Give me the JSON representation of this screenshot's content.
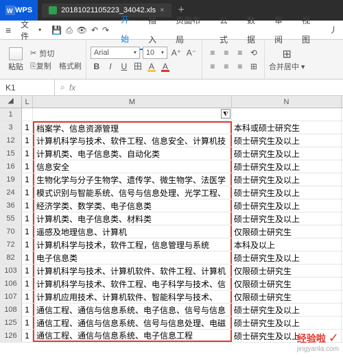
{
  "titlebar": {
    "app": "WPS",
    "tab_filename": "20181021105223_34042.xls",
    "add_tab": "+"
  },
  "menubar": {
    "hamburger": "≡",
    "file": "文件",
    "items": [
      "开始",
      "插入",
      "页面布局",
      "公式",
      "数据",
      "审阅",
      "视图",
      "丿"
    ],
    "active_index": 0
  },
  "toolbar": {
    "paste": "粘贴",
    "cut": "剪切",
    "copy": "复制",
    "format_painter": "格式刷",
    "font_name": "Arial",
    "font_size": "10",
    "bold": "B",
    "italic": "I",
    "underline": "U",
    "inc_font": "A⁺",
    "dec_font": "A⁻",
    "merge": "合并居中"
  },
  "cellref": {
    "address": "K1",
    "fx": "fx",
    "search": "⌕"
  },
  "columns": {
    "blank": "◢",
    "L": "L",
    "M": "M",
    "N": "N"
  },
  "filter_icon": "⧨",
  "rows": [
    {
      "n": "1",
      "l": "",
      "m": "",
      "n2": ""
    },
    {
      "n": "3",
      "l": "1",
      "m": "档案学、信息资源管理",
      "n2": "本科或硕士研究生"
    },
    {
      "n": "12",
      "l": "1",
      "m": "计算机科学与技术、软件工程、信息安全、计算机技",
      "n2": "硕士研究生及以上"
    },
    {
      "n": "15",
      "l": "1",
      "m": "计算机类、电子信息类、自动化类",
      "n2": "硕士研究生及以上"
    },
    {
      "n": "16",
      "l": "1",
      "m": "信息安全",
      "n2": "硕士研究生及以上"
    },
    {
      "n": "19",
      "l": "1",
      "m": "生物化学与分子生物学、遗传学、微生物学、法医学",
      "n2": "硕士研究生及以上"
    },
    {
      "n": "24",
      "l": "1",
      "m": "模式识别与智能系统、信号与信息处理、光学工程、",
      "n2": "硕士研究生及以上"
    },
    {
      "n": "36",
      "l": "1",
      "m": "经济学类、数学类、电子信息类",
      "n2": "硕士研究生及以上"
    },
    {
      "n": "55",
      "l": "1",
      "m": "计算机类、电子信息类、材料类",
      "n2": "硕士研究生及以上"
    },
    {
      "n": "70",
      "l": "1",
      "m": "遥感及地理信息、计算机",
      "n2": "仅限硕士研究生"
    },
    {
      "n": "72",
      "l": "1",
      "m": "计算机科学与技术，软件工程，信息管理与系统",
      "n2": "本科及以上"
    },
    {
      "n": "82",
      "l": "1",
      "m": "电子信息类",
      "n2": "硕士研究生及以上"
    },
    {
      "n": "103",
      "l": "1",
      "m": "计算机科学与技术、计算机软件、软件工程、计算机",
      "n2": "仅限硕士研究生"
    },
    {
      "n": "106",
      "l": "1",
      "m": "计算机科学与技术、软件工程、电子科学与技术、信",
      "n2": "仅限硕士研究生"
    },
    {
      "n": "107",
      "l": "1",
      "m": "计算机应用技术、计算机软件、智能科学与技术、",
      "n2": "仅限硕士研究生"
    },
    {
      "n": "108",
      "l": "1",
      "m": "通信工程、通信与信息系统、电子信息、信号与信息",
      "n2": "硕士研究生及以上"
    },
    {
      "n": "125",
      "l": "1",
      "m": "通信工程、通信与信息系统、信号与信息处理、电磁",
      "n2": "硕士研究生及以上"
    },
    {
      "n": "126",
      "l": "1",
      "m": "通信工程、通信与信息系统、电子信息工程",
      "n2": "硕士研究生及以上"
    }
  ],
  "watermark": {
    "main": "经验啦",
    "check": "✓",
    "sub": "jingyanla.com"
  }
}
